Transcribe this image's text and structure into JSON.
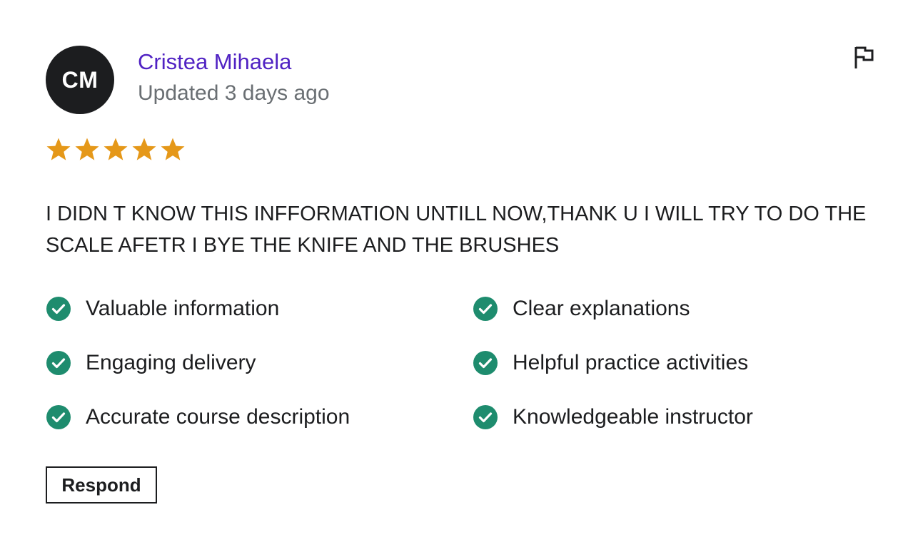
{
  "review": {
    "avatar_initials": "CM",
    "author_name": "Cristea Mihaela",
    "updated_text": "Updated 3 days ago",
    "rating": 5,
    "rating_max": 5,
    "star_color": "#e59819",
    "comment": "I DIDN T KNOW THIS INFFORMATION UNTILL NOW,THANK U I WILL TRY TO DO THE SCALE AFETR I BYE THE KNIFE AND THE BRUSHES",
    "flag_icon": "flag-icon"
  },
  "tags": [
    {
      "label": "Valuable information",
      "icon": "check-circle-icon"
    },
    {
      "label": "Clear explanations",
      "icon": "check-circle-icon"
    },
    {
      "label": "Engaging delivery",
      "icon": "check-circle-icon"
    },
    {
      "label": "Helpful practice activities",
      "icon": "check-circle-icon"
    },
    {
      "label": "Accurate course description",
      "icon": "check-circle-icon"
    },
    {
      "label": "Knowledgeable instructor",
      "icon": "check-circle-icon"
    }
  ],
  "tag_check_color": "#1e8c6e",
  "actions": {
    "respond_label": "Respond"
  },
  "colors": {
    "author_link": "#5022c3",
    "muted_text": "#6a6f73",
    "avatar_bg": "#1c1d1f"
  }
}
